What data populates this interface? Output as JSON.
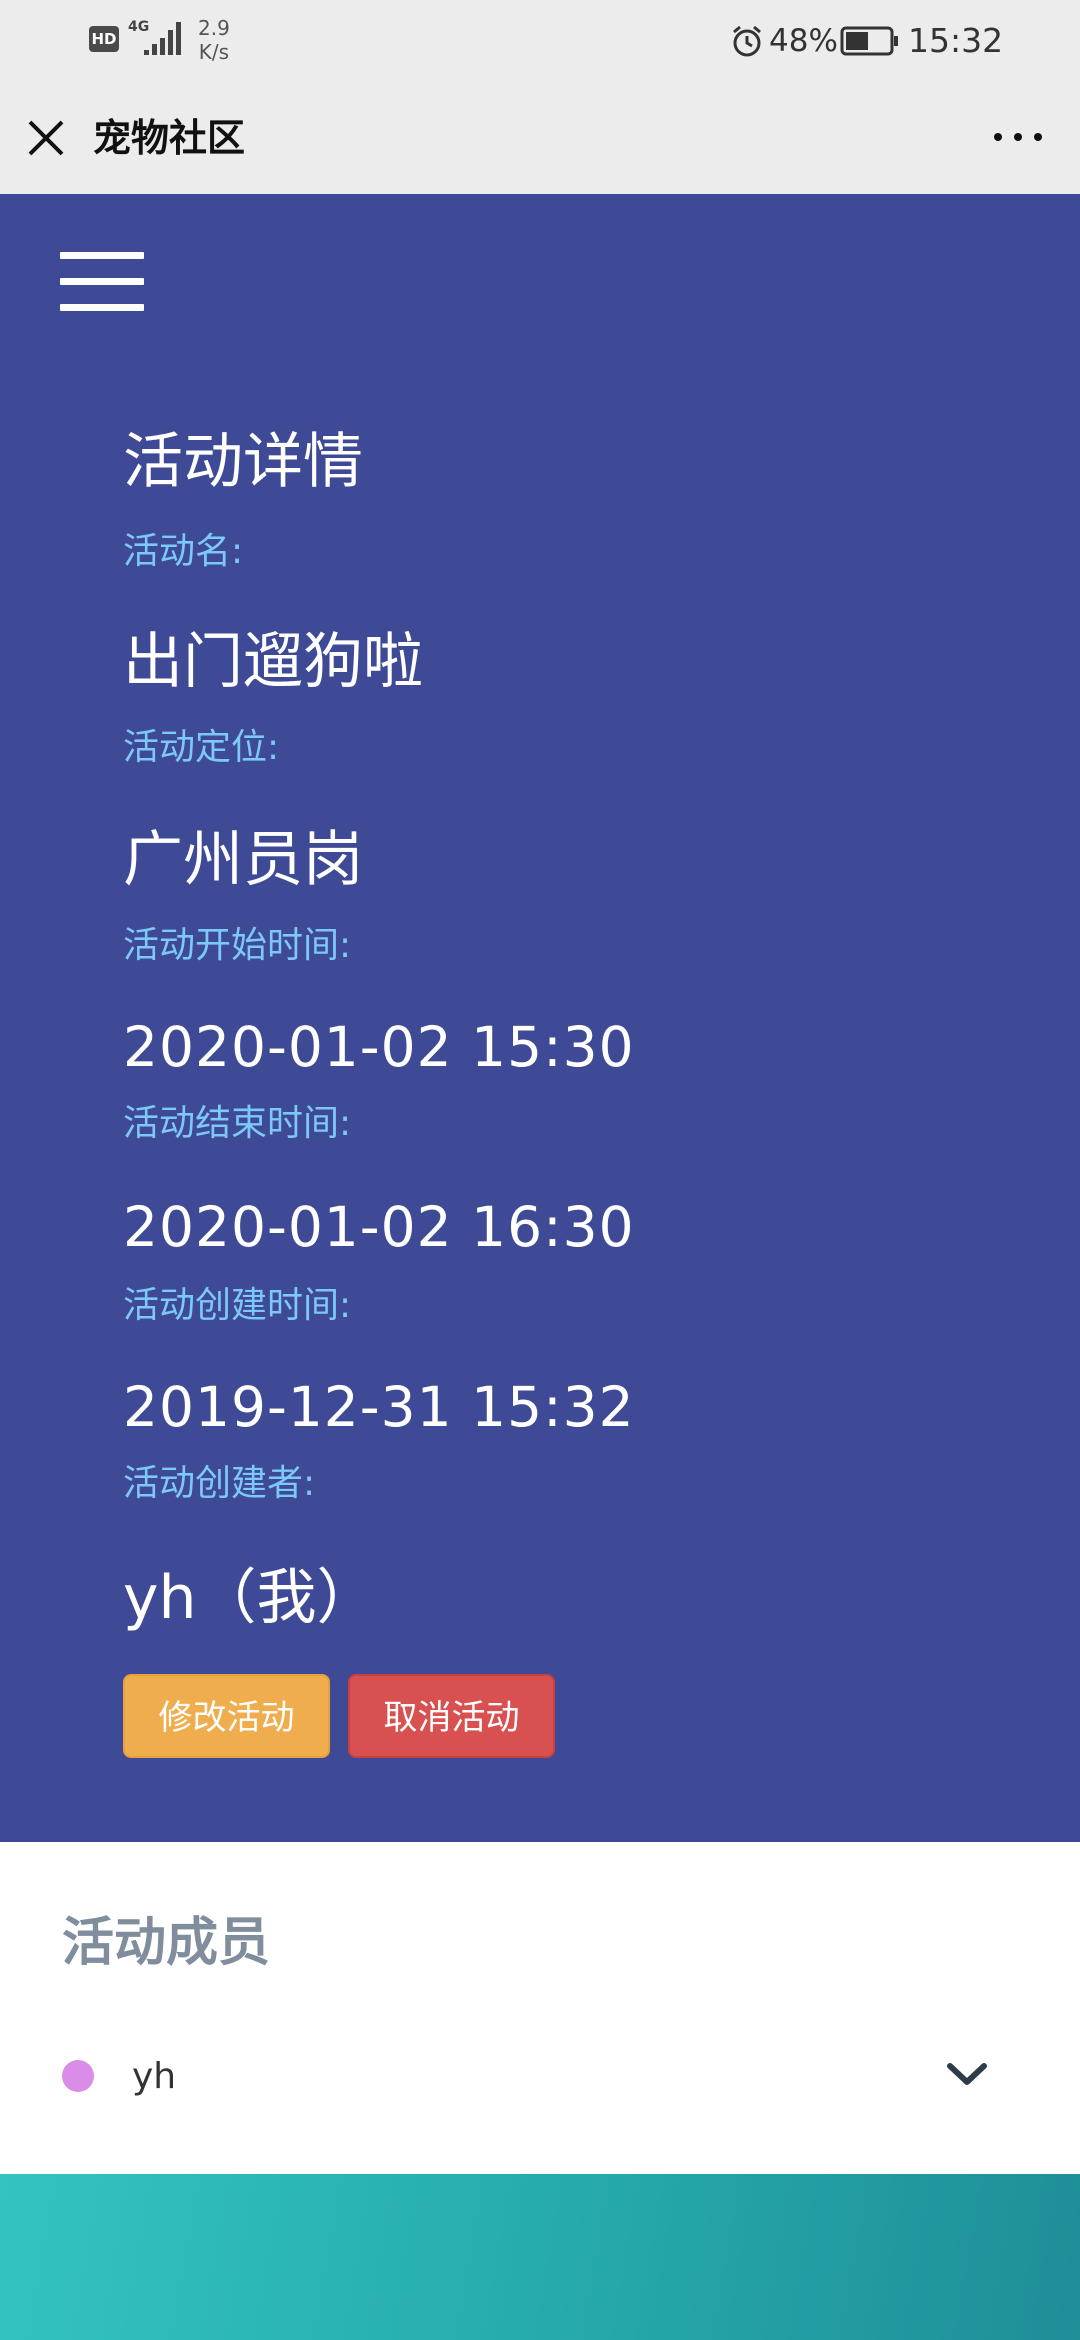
{
  "status_bar": {
    "hd": "HD",
    "network": "4G",
    "speed_value": "2.9",
    "speed_unit": "K/s",
    "battery": "48%",
    "time": "15:32"
  },
  "title_bar": {
    "title": "宠物社区"
  },
  "activity": {
    "heading": "活动详情",
    "name_label": "活动名:",
    "name": "出门遛狗啦",
    "location_label": "活动定位:",
    "location": "广州员岗",
    "start_label": "活动开始时间:",
    "start_time": "2020-01-02 15:30",
    "end_label": "活动结束时间:",
    "end_time": "2020-01-02 16:30",
    "created_label": "活动创建时间:",
    "created_time": "2019-12-31 15:32",
    "creator_label": "活动创建者:",
    "creator": "yh（我）",
    "edit_button": "修改活动",
    "cancel_button": "取消活动"
  },
  "members": {
    "title": "活动成员",
    "items": [
      {
        "name": "yh",
        "dot_color": "#d98ce8"
      }
    ]
  },
  "colors": {
    "hero_bg": "#3f4a96",
    "label": "#7cc8f7",
    "edit_btn": "#efad4e",
    "cancel_btn": "#d8504f"
  }
}
